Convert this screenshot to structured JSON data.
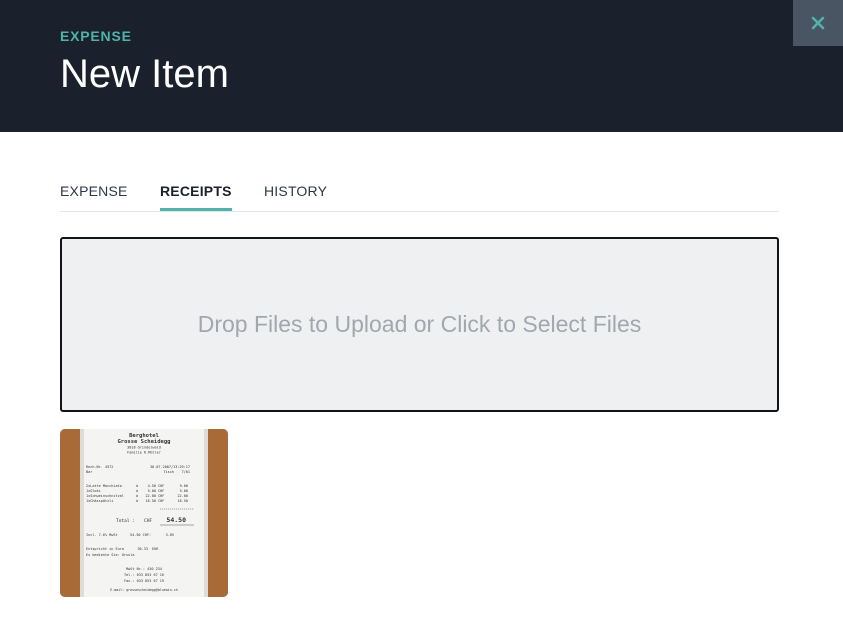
{
  "header": {
    "eyebrow": "EXPENSE",
    "title": "New Item",
    "close_icon": "close-icon"
  },
  "tabs": [
    {
      "label": "EXPENSE",
      "active": false
    },
    {
      "label": "RECEIPTS",
      "active": true
    },
    {
      "label": "HISTORY",
      "active": false
    }
  ],
  "dropzone": {
    "text": "Drop Files to Upload or Click to Select Files"
  },
  "receipt": {
    "lines": [
      "Berghotel",
      "Grosse Scheidegg",
      "3818 Grindelwald",
      "Familie R.Müller",
      "Rech.Nr. 4572",
      "30.07.2007/13:29:17",
      "Bar",
      "Tisch",
      "7/01",
      "2xLatte Macchiato",
      "à",
      "4.50",
      "CHF",
      "9.00",
      "1xGloki",
      "à",
      "5.00",
      "CHF",
      "5.00",
      "1xSchweinschnitzel",
      "à",
      "22.00",
      "CHF",
      "22.00",
      "1xChässpätzli",
      "à",
      "18.50",
      "CHF",
      "18.50",
      "Total :",
      "CHF",
      "54.50",
      "Incl. 7.6% MwSt",
      "54.50 CHF:",
      "3.85",
      "Entspricht in Euro",
      "36.33",
      "EUR",
      "Es bediente Sie: Ursula",
      "MwSt Nr.: 430 234",
      "Tel.: 033 853 67 16",
      "Fax.: 033 853 67 19",
      "E-mail: grossescheidegg@bluewin.ch"
    ]
  },
  "colors": {
    "header_bg": "#1a202c",
    "accent": "#4fb3a9",
    "close_bg": "#4a5563",
    "dropzone_bg": "#eff0f2"
  }
}
